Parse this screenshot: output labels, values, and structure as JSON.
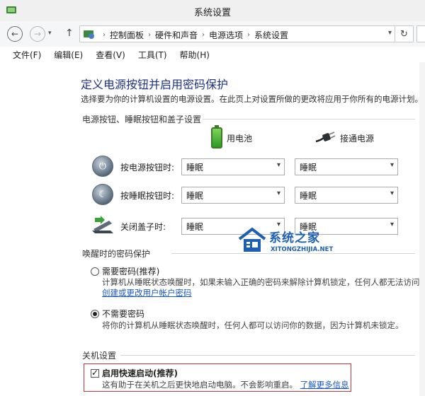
{
  "window": {
    "title": "系统设置"
  },
  "nav": {
    "breadcrumbs": [
      "控制面板",
      "硬件和声音",
      "电源选项",
      "系统设置"
    ]
  },
  "menu": [
    "文件(F)",
    "编辑(E)",
    "查看(V)",
    "工具(T)",
    "帮助(H)"
  ],
  "page": {
    "heading": "定义电源按钮并启用密码保护",
    "description": "选择要为你的计算机设置的电源设置。在此页上对设置所做的更改将应用于你所有的电源计划。"
  },
  "power_buttons": {
    "section_title": "电源按钮、睡眠按钮和盖子设置",
    "col_battery": "用电池",
    "col_plugged": "接通电源",
    "rows": [
      {
        "label": "按电源按钮时:",
        "battery": "睡眠",
        "plugged": "睡眠"
      },
      {
        "label": "按睡眠按钮时:",
        "battery": "睡眠",
        "plugged": "睡眠"
      },
      {
        "label": "关闭盖子时:",
        "battery": "睡眠",
        "plugged": "睡眠"
      }
    ]
  },
  "wake_password": {
    "section_title": "唤醒时的密码保护",
    "require": {
      "label": "需要密码(推荐)",
      "desc": "计算机从睡眠状态唤醒时，如果未输入正确的密码来解除计算机锁定，任何人都无法访问",
      "link": "创建或更改用户帐户密码"
    },
    "no_require": {
      "label": "不需要密码",
      "desc": "将你的计算机从睡眠状态唤醒时，任何人都可以访问你的数据，因为计算机未锁定。"
    },
    "selected": "no_require"
  },
  "shutdown": {
    "section_title": "关机设置",
    "fast_startup": {
      "label": "启用快速启动(推荐)",
      "desc": "这有助于在关机之后更快地启动电脑。不会影响重启。",
      "link": "了解更多信息",
      "checked": true
    }
  },
  "watermark": {
    "text": "系统之家",
    "subtext": "XITONGZHIJIA.NET"
  },
  "colors": {
    "heading": "#1e3287",
    "link": "#1a56c9",
    "highlight": "#c0363a"
  }
}
